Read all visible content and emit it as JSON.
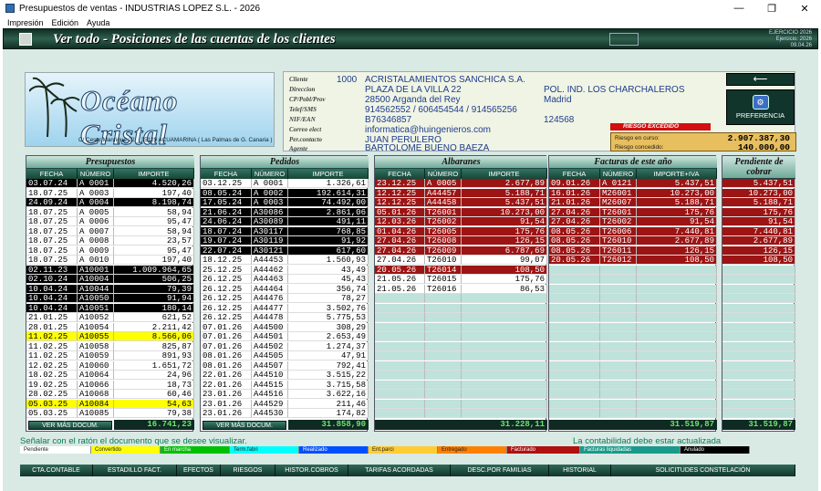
{
  "window": {
    "title": "Presupuestos de ventas - INDUSTRIAS LOPEZ S.L. - 2026",
    "controls": [
      "—",
      "❐",
      "✕"
    ]
  },
  "menu": [
    "Impresión",
    "Edición",
    "Ayuda"
  ],
  "header": {
    "title": "Ver todo - Posiciones de las cuentas de los clientes",
    "right_line1": "EJERCICIO 2026",
    "right_line2": "Ejercicio: 2026",
    "right_line3": "09.04.26"
  },
  "brand": {
    "name": "Océano Cristal",
    "address": "C/ Cesar Manrique 22 _ 35129 ACUAMARINA ( Las Palmas de G. Canaria )"
  },
  "client": {
    "labels": {
      "cliente": "Cliente",
      "direccion": "Direccion",
      "cp": "CP/Pobl/Prov",
      "telef": "Telef/SMS",
      "nif": "NIF/EAN",
      "correo": "Correo elect",
      "percontacto": "Per.contacto",
      "agente": "Agente"
    },
    "numero": "1000",
    "nombre": "ACRISTALAMIENTOS SANCHICA S.A.",
    "direccion": "PLAZA DE LA VILLA 22",
    "direccion2": "POL. IND. LOS CHARCHALEROS",
    "cp": "28500 Arganda del Rey",
    "provincia": "Madrid",
    "telef": "914562552 / 606454544 / 914565256",
    "nif": "B76346857",
    "ean": "124568",
    "correo": "informatica@huingenieros.com",
    "contacto": "JUAN PERULERO",
    "agente": "BARTOLOME BUENO BAEZA",
    "riesgo_excedido": "RIESGO EXCEDIDO",
    "riesgo_curso_label": "Riesgo en curso:",
    "riesgo_curso": "2.907.387,30",
    "riesgo_concedido_label": "Riesgo concedido:",
    "riesgo_concedido": "140.000,00"
  },
  "buttons": {
    "back": "⟵",
    "preferencia": "PREFERENCIA",
    "ver_mas": "VER MÁS DOCUM."
  },
  "columns": {
    "fecha": "FECHA",
    "numero": "NÚMERO",
    "importe": "IMPORTE",
    "importe_iva": "IMPORTE+IVA"
  },
  "presupuestos": {
    "title": "Presupuestos",
    "total": "16.741,23",
    "rows": [
      [
        "03.07.24",
        "A 0001",
        "4.520,26",
        "b"
      ],
      [
        "18.07.25",
        "A 0003",
        "197,40",
        ""
      ],
      [
        "24.09.24",
        "A 0004",
        "8.198,74",
        "b"
      ],
      [
        "18.07.25",
        "A 0005",
        "58,94",
        ""
      ],
      [
        "18.07.25",
        "A 0006",
        "95,47",
        ""
      ],
      [
        "18.07.25",
        "A 0007",
        "58,94",
        ""
      ],
      [
        "18.07.25",
        "A 0008",
        "23,57",
        ""
      ],
      [
        "18.07.25",
        "A 0009",
        "95,47",
        ""
      ],
      [
        "18.07.25",
        "A 0010",
        "197,40",
        ""
      ],
      [
        "02.11.23",
        "A10001",
        "1.009.964,65",
        "b"
      ],
      [
        "02.10.24",
        "A10004",
        "506,25",
        "b"
      ],
      [
        "10.04.24",
        "A10044",
        "79,39",
        "b"
      ],
      [
        "10.04.24",
        "A10050",
        "91,94",
        "b"
      ],
      [
        "10.04.24",
        "A10051",
        "180,14",
        "b"
      ],
      [
        "21.01.25",
        "A10052",
        "621,52",
        ""
      ],
      [
        "28.01.25",
        "A10054",
        "2.211,42",
        ""
      ],
      [
        "11.02.25",
        "A10055",
        "8.566,06",
        "y"
      ],
      [
        "11.02.25",
        "A10058",
        "825,87",
        ""
      ],
      [
        "11.02.25",
        "A10059",
        "891,93",
        ""
      ],
      [
        "12.02.25",
        "A10060",
        "1.651,72",
        ""
      ],
      [
        "18.02.25",
        "A10064",
        "24,96",
        ""
      ],
      [
        "19.02.25",
        "A10066",
        "18,73",
        ""
      ],
      [
        "28.02.25",
        "A10068",
        "60,46",
        ""
      ],
      [
        "05.03.25",
        "A10084",
        "54,63",
        "y"
      ],
      [
        "05.03.25",
        "A10085",
        "79,38",
        ""
      ]
    ]
  },
  "pedidos": {
    "title": "Pedidos",
    "total": "31.858,90",
    "rows": [
      [
        "03.12.25",
        "A 0001",
        "1.326,61",
        ""
      ],
      [
        "08.05.24",
        "A 0002",
        "192.614,31",
        "b"
      ],
      [
        "17.05.24",
        "A 0003",
        "74.492,00",
        "b"
      ],
      [
        "21.06.24",
        "A30086",
        "2.861,06",
        "b"
      ],
      [
        "24.06.24",
        "A30089",
        "491,11",
        "b"
      ],
      [
        "18.07.24",
        "A30117",
        "768,85",
        "b"
      ],
      [
        "19.07.24",
        "A30119",
        "91,92",
        "b"
      ],
      [
        "22.07.24",
        "A30121",
        "617,60",
        "b"
      ],
      [
        "18.12.25",
        "A44453",
        "1.560,93",
        ""
      ],
      [
        "25.12.25",
        "A44462",
        "43,49",
        ""
      ],
      [
        "26.12.25",
        "A44463",
        "45,43",
        ""
      ],
      [
        "26.12.25",
        "A44464",
        "356,74",
        ""
      ],
      [
        "26.12.25",
        "A44476",
        "78,27",
        ""
      ],
      [
        "26.12.25",
        "A44477",
        "3.502,76",
        ""
      ],
      [
        "26.12.25",
        "A44478",
        "5.775,53",
        ""
      ],
      [
        "07.01.26",
        "A44500",
        "308,29",
        ""
      ],
      [
        "07.01.26",
        "A44501",
        "2.653,49",
        ""
      ],
      [
        "07.01.26",
        "A44502",
        "1.274,37",
        ""
      ],
      [
        "08.01.26",
        "A44505",
        "47,91",
        ""
      ],
      [
        "08.01.26",
        "A44507",
        "792,41",
        ""
      ],
      [
        "22.01.26",
        "A44510",
        "3.515,22",
        ""
      ],
      [
        "22.01.26",
        "A44515",
        "3.715,58",
        ""
      ],
      [
        "23.01.26",
        "A44516",
        "3.622,16",
        ""
      ],
      [
        "23.01.26",
        "A44529",
        "211,46",
        ""
      ],
      [
        "23.01.26",
        "A44530",
        "174,82",
        ""
      ]
    ]
  },
  "albaranes": {
    "title": "Albaranes",
    "total": "31.228,11",
    "rows": [
      [
        "23.12.25",
        "A 0005",
        "2.677,89",
        "r"
      ],
      [
        "12.12.25",
        "A44457",
        "5.188,71",
        "r"
      ],
      [
        "12.12.25",
        "A44458",
        "5.437,51",
        "r"
      ],
      [
        "05.01.26",
        "T26001",
        "10.273,00",
        "r"
      ],
      [
        "12.03.26",
        "T26002",
        "91,54",
        "r"
      ],
      [
        "01.04.26",
        "T26005",
        "175,76",
        "r"
      ],
      [
        "27.04.26",
        "T26008",
        "126,15",
        "r"
      ],
      [
        "27.04.26",
        "T26009",
        "6.787,69",
        "r"
      ],
      [
        "27.04.26",
        "T26010",
        "99,07",
        ""
      ],
      [
        "20.05.26",
        "T26014",
        "108,50",
        "r"
      ],
      [
        "21.05.26",
        "T26015",
        "175,76",
        ""
      ],
      [
        "21.05.26",
        "T26016",
        "86,53",
        ""
      ]
    ]
  },
  "facturas": {
    "title": "Facturas de este año",
    "total": "31.519,87",
    "rows": [
      [
        "09.01.26",
        "A 0121",
        "5.437,51"
      ],
      [
        "16.01.26",
        "M26001",
        "10.273,00"
      ],
      [
        "21.01.26",
        "M26007",
        "5.188,71"
      ],
      [
        "27.04.26",
        "T26001",
        "175,76"
      ],
      [
        "27.04.26",
        "T26002",
        "91,54"
      ],
      [
        "08.05.26",
        "T26006",
        "7.440,81"
      ],
      [
        "08.05.26",
        "T26010",
        "2.677,89"
      ],
      [
        "08.05.26",
        "T26011",
        "126,15"
      ],
      [
        "20.05.26",
        "T26012",
        "108,50"
      ]
    ]
  },
  "pendiente": {
    "title": "Pendiente de cobrar",
    "total": "31.519,87",
    "values": [
      "5.437,51",
      "10.273,00",
      "5.188,71",
      "175,76",
      "91,54",
      "7.440,81",
      "2.677,89",
      "126,15",
      "108,50"
    ]
  },
  "hint": "Señalar con el ratón el documento que se desee visualizar.",
  "contab": "La contabilidad debe estar actualizada",
  "legend": [
    [
      "Pendiente",
      "#ffffff"
    ],
    [
      "Convertido",
      "#ffff00"
    ],
    [
      "En marcha",
      "#00c000"
    ],
    [
      "Term.fabri",
      "#00ffff"
    ],
    [
      "Realizado",
      "#0050ff"
    ],
    [
      "Ent.parci",
      "#ffcc33"
    ],
    [
      "Entregado",
      "#ff8000"
    ],
    [
      "Facturado",
      "#b01010"
    ],
    [
      "Facturas liquidadas",
      "#1a9a8a"
    ],
    [
      "Anulado",
      "#000000"
    ]
  ],
  "bottom_buttons": [
    "CTA.CONTABLE",
    "ESTADILLO FACT.",
    "EFECTOS",
    "RIESGOS",
    "HISTOR.COBROS",
    "TARIFAS ACORDADAS",
    "DESC.POR FAMILIAS",
    "HISTORIAL",
    "SOLICITUDES CONSTELACIÓN"
  ]
}
